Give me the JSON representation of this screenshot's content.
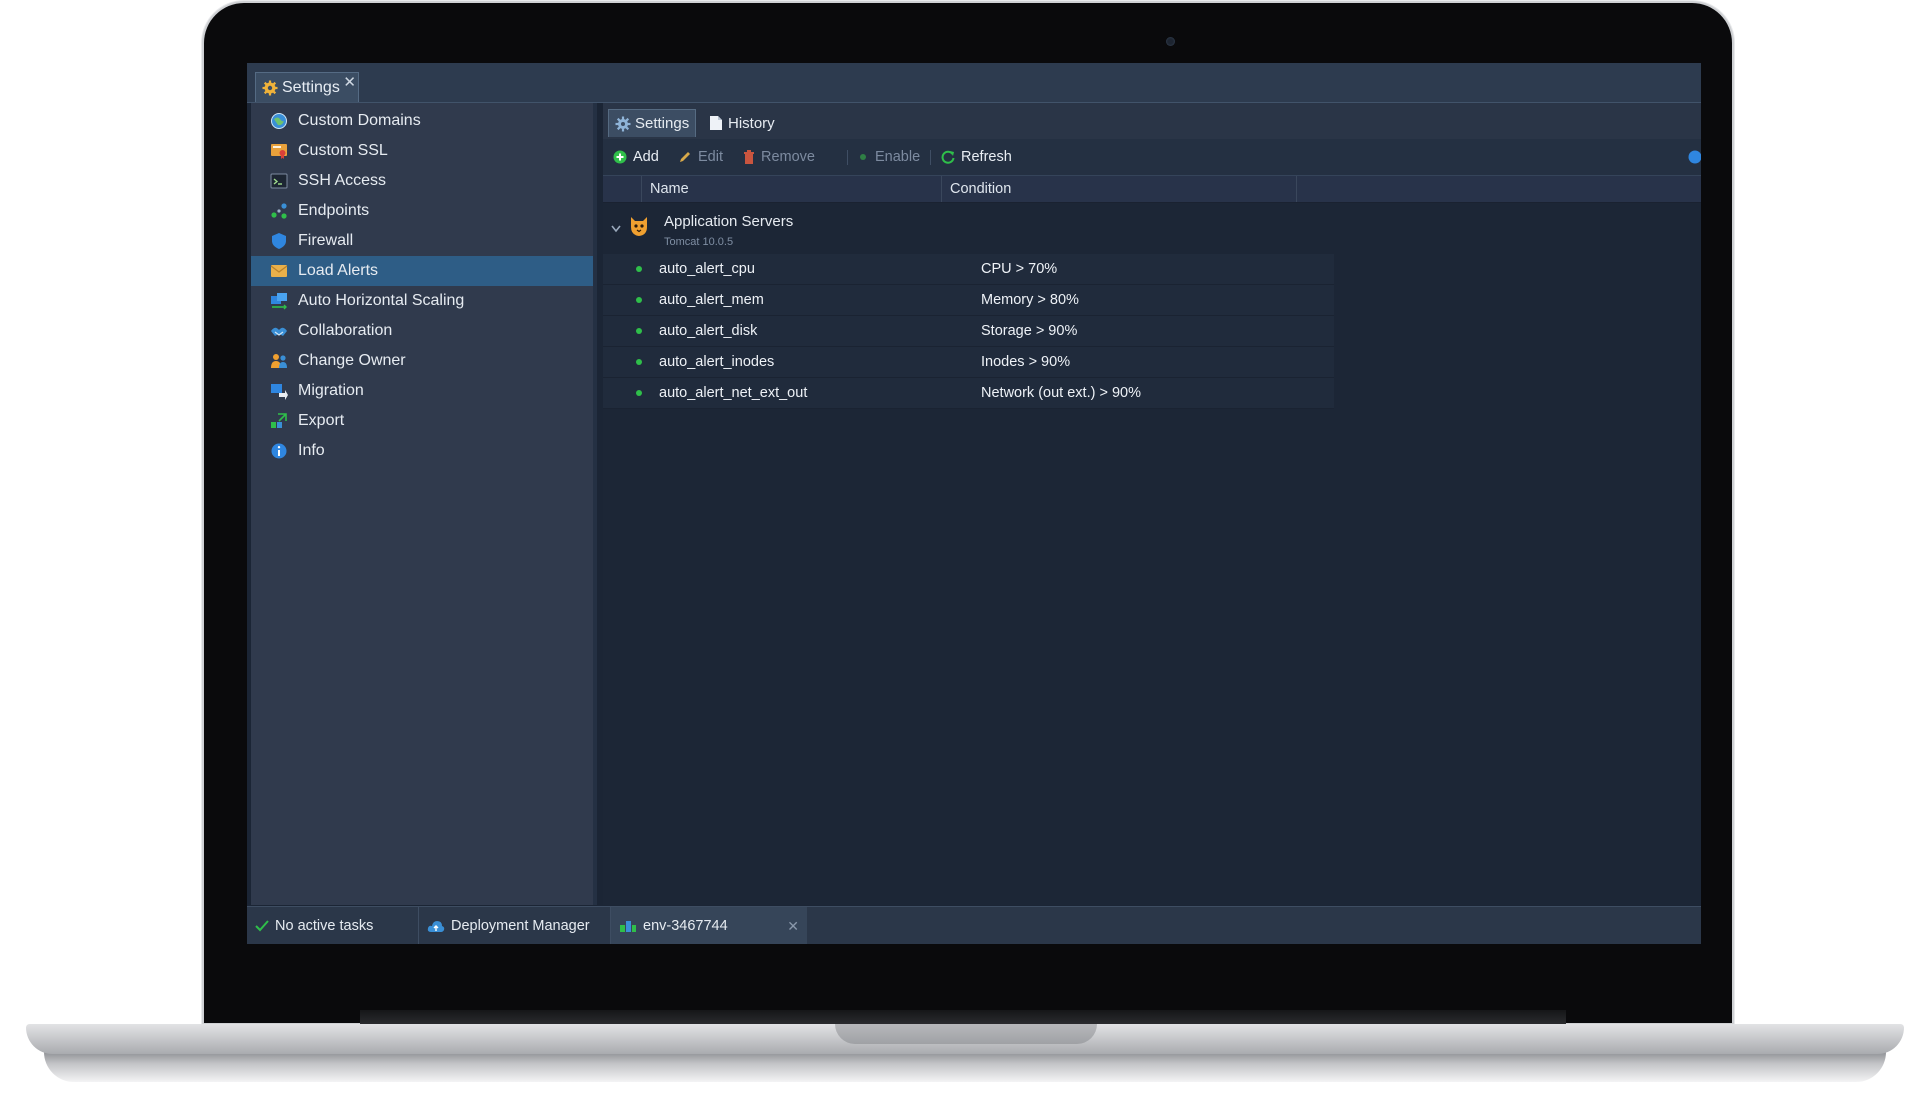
{
  "window": {
    "tab_title": "Settings",
    "tab_close": "✕"
  },
  "sidebar": {
    "items": [
      {
        "label": "Custom Domains",
        "icon": "globe-icon"
      },
      {
        "label": "Custom SSL",
        "icon": "certificate-icon"
      },
      {
        "label": "SSH Access",
        "icon": "terminal-icon"
      },
      {
        "label": "Endpoints",
        "icon": "endpoints-icon"
      },
      {
        "label": "Firewall",
        "icon": "shield-icon"
      },
      {
        "label": "Load Alerts",
        "icon": "alert-envelope-icon",
        "active": true
      },
      {
        "label": "Auto Horizontal Scaling",
        "icon": "scaling-icon"
      },
      {
        "label": "Collaboration",
        "icon": "handshake-icon"
      },
      {
        "label": "Change Owner",
        "icon": "users-icon"
      },
      {
        "label": "Migration",
        "icon": "migration-icon"
      },
      {
        "label": "Export",
        "icon": "export-icon"
      },
      {
        "label": "Info",
        "icon": "info-icon"
      }
    ]
  },
  "main": {
    "tabs": [
      {
        "label": "Settings",
        "icon": "gear-icon",
        "active": true
      },
      {
        "label": "History",
        "icon": "document-icon"
      }
    ],
    "toolbar": {
      "add": "Add",
      "edit": "Edit",
      "remove": "Remove",
      "enable": "Enable",
      "refresh": "Refresh"
    },
    "columns": [
      "Name",
      "Condition"
    ],
    "group": {
      "title": "Application Servers",
      "subtitle": "Tomcat 10.0.5"
    },
    "alerts": [
      {
        "name": "auto_alert_cpu",
        "condition": "CPU > 70%"
      },
      {
        "name": "auto_alert_mem",
        "condition": "Memory > 80%"
      },
      {
        "name": "auto_alert_disk",
        "condition": "Storage > 90%"
      },
      {
        "name": "auto_alert_inodes",
        "condition": "Inodes > 90%"
      },
      {
        "name": "auto_alert_net_ext_out",
        "condition": "Network (out ext.) > 90%"
      }
    ]
  },
  "taskbar": {
    "status": "No active tasks",
    "deployment_manager": "Deployment Manager",
    "env": "env-3467744",
    "env_close": "✕"
  },
  "colors": {
    "accent": "#2e5d86",
    "status_green": "#2fbf4a",
    "background": "#1c2636"
  }
}
